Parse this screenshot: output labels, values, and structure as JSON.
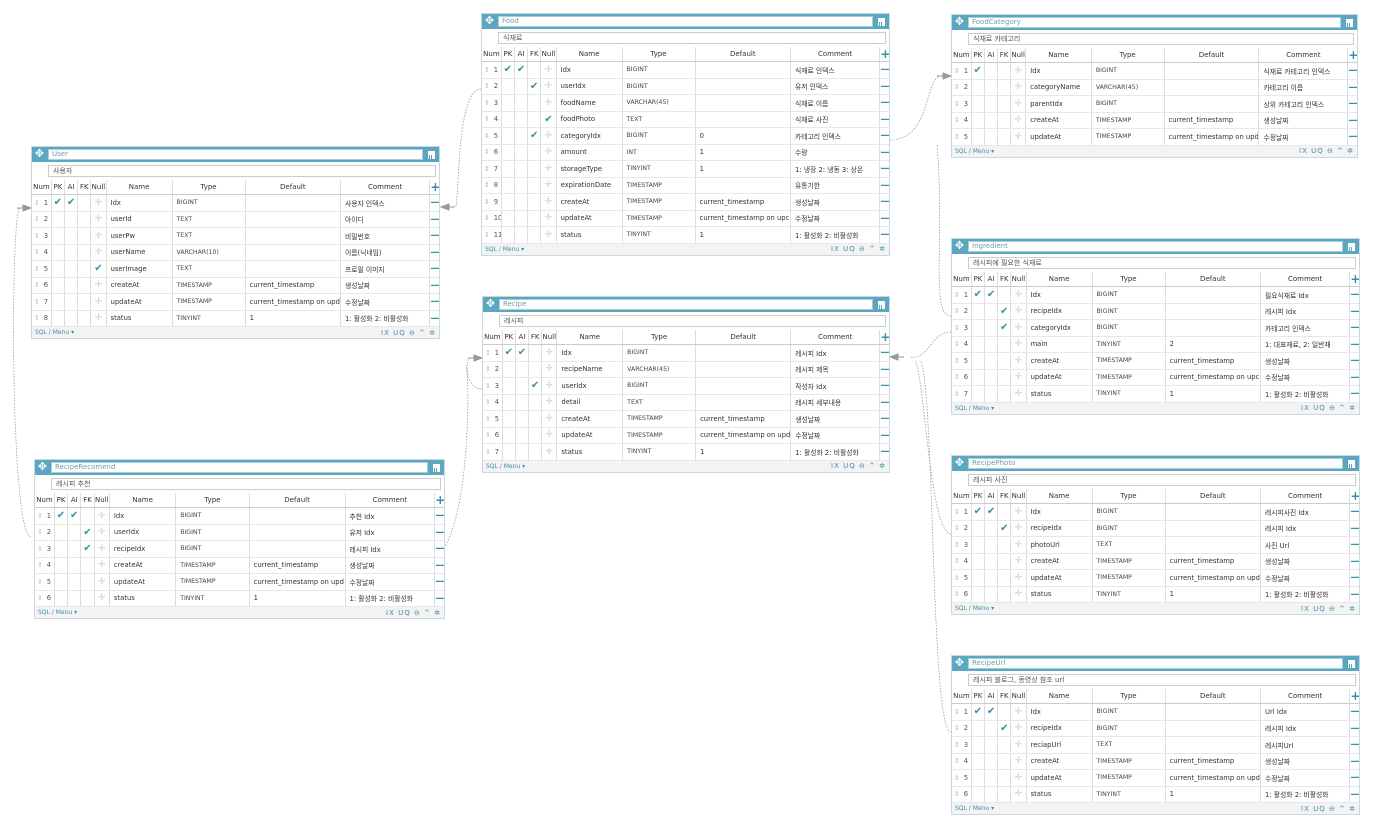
{
  "labels": {
    "num": "Num",
    "pk": "PK",
    "ai": "AI",
    "fk": "FK",
    "null": "Null",
    "name": "Name",
    "type": "Type",
    "default": "Default",
    "comment": "Comment",
    "sql_menu": "SQL / Menu",
    "footer_icons": "IX UQ ⊖ ^ ✲"
  },
  "colors": {
    "header": "#5aa7bf",
    "accent": "#3a8fa7",
    "link": "#999999"
  },
  "icons": {
    "drag": "move-icon",
    "delete": "trash-icon",
    "add": "plus-icon",
    "remove": "minus-icon",
    "pk": "check-icon",
    "null": "cross-icon",
    "handle": "drag-handle-icon"
  },
  "tables": [
    {
      "id": "user",
      "name": "User",
      "comment": "사용자",
      "rows": [
        {
          "n": "1",
          "pk": true,
          "ai": true,
          "fk": false,
          "nl": false,
          "name": "Idx",
          "type": "BIGINT",
          "def": "",
          "com": "사용자 인덱스"
        },
        {
          "n": "2",
          "pk": false,
          "ai": false,
          "fk": false,
          "nl": false,
          "name": "userId",
          "type": "TEXT",
          "def": "",
          "com": "아이디"
        },
        {
          "n": "3",
          "pk": false,
          "ai": false,
          "fk": false,
          "nl": false,
          "name": "userPw",
          "type": "TEXT",
          "def": "",
          "com": "비밀번호"
        },
        {
          "n": "4",
          "pk": false,
          "ai": false,
          "fk": false,
          "nl": false,
          "name": "userName",
          "type": "VARCHAR(10)",
          "def": "",
          "com": "이름(닉네임)"
        },
        {
          "n": "5",
          "pk": false,
          "ai": false,
          "fk": false,
          "nl": true,
          "name": "userImage",
          "type": "TEXT",
          "def": "",
          "com": "프로필 이미지"
        },
        {
          "n": "6",
          "pk": false,
          "ai": false,
          "fk": false,
          "nl": false,
          "name": "createAt",
          "type": "TIMESTAMP",
          "def": "current_timestamp",
          "com": "생성날짜"
        },
        {
          "n": "7",
          "pk": false,
          "ai": false,
          "fk": false,
          "nl": false,
          "name": "updateAt",
          "type": "TIMESTAMP",
          "def": "current_timestamp on upd",
          "com": "수정날짜"
        },
        {
          "n": "8",
          "pk": false,
          "ai": false,
          "fk": false,
          "nl": false,
          "name": "status",
          "type": "TINYINT",
          "def": "1",
          "com": "1: 활성화 2: 비활성화"
        }
      ]
    },
    {
      "id": "reciperecomend",
      "name": "RecipeRecomend",
      "comment": "레시피 추천",
      "rows": [
        {
          "n": "1",
          "pk": true,
          "ai": true,
          "fk": false,
          "nl": false,
          "name": "Idx",
          "type": "BIGINT",
          "def": "",
          "com": "추천 Idx"
        },
        {
          "n": "2",
          "pk": false,
          "ai": false,
          "fk": true,
          "nl": false,
          "name": "userIdx",
          "type": "BIGINT",
          "def": "",
          "com": "유저 Idx"
        },
        {
          "n": "3",
          "pk": false,
          "ai": false,
          "fk": true,
          "nl": false,
          "name": "recipeIdx",
          "type": "BIGINT",
          "def": "",
          "com": "레시피 Idx"
        },
        {
          "n": "4",
          "pk": false,
          "ai": false,
          "fk": false,
          "nl": false,
          "name": "createAt",
          "type": "TIMESTAMP",
          "def": "current_timestamp",
          "com": "생성날짜"
        },
        {
          "n": "5",
          "pk": false,
          "ai": false,
          "fk": false,
          "nl": false,
          "name": "updateAt",
          "type": "TIMESTAMP",
          "def": "current_timestamp on upd",
          "com": "수정날짜"
        },
        {
          "n": "6",
          "pk": false,
          "ai": false,
          "fk": false,
          "nl": false,
          "name": "status",
          "type": "TINYINT",
          "def": "1",
          "com": "1: 활성화 2: 비활성화"
        }
      ]
    },
    {
      "id": "food",
      "name": "Food",
      "comment": "식재료",
      "rows": [
        {
          "n": "1",
          "pk": true,
          "ai": true,
          "fk": false,
          "nl": false,
          "name": "Idx",
          "type": "BIGINT",
          "def": "",
          "com": "식재료 인덱스"
        },
        {
          "n": "2",
          "pk": false,
          "ai": false,
          "fk": true,
          "nl": false,
          "name": "userIdx",
          "type": "BIGINT",
          "def": "",
          "com": "유저 인덱스"
        },
        {
          "n": "3",
          "pk": false,
          "ai": false,
          "fk": false,
          "nl": false,
          "name": "foodName",
          "type": "VARCHAR(45)",
          "def": "",
          "com": "식재료 이름"
        },
        {
          "n": "4",
          "pk": false,
          "ai": false,
          "fk": false,
          "nl": true,
          "name": "foodPhoto",
          "type": "TEXT",
          "def": "",
          "com": "식재료 사진"
        },
        {
          "n": "5",
          "pk": false,
          "ai": false,
          "fk": true,
          "nl": false,
          "name": "categoryIdx",
          "type": "BIGINT",
          "def": "0",
          "com": "카테고리 인덱스"
        },
        {
          "n": "6",
          "pk": false,
          "ai": false,
          "fk": false,
          "nl": false,
          "name": "amount",
          "type": "INT",
          "def": "1",
          "com": "수량"
        },
        {
          "n": "7",
          "pk": false,
          "ai": false,
          "fk": false,
          "nl": false,
          "name": "storageType",
          "type": "TINYINT",
          "def": "1",
          "com": "1: 냉장 2: 냉동 3: 상온"
        },
        {
          "n": "8",
          "pk": false,
          "ai": false,
          "fk": false,
          "nl": false,
          "name": "expirationDate",
          "type": "TIMESTAMP",
          "def": "",
          "com": "유통기한"
        },
        {
          "n": "9",
          "pk": false,
          "ai": false,
          "fk": false,
          "nl": false,
          "name": "createAt",
          "type": "TIMESTAMP",
          "def": "current_timestamp",
          "com": "생성날짜"
        },
        {
          "n": "10",
          "pk": false,
          "ai": false,
          "fk": false,
          "nl": false,
          "name": "updateAt",
          "type": "TIMESTAMP",
          "def": "current_timestamp on upc",
          "com": "수정날짜"
        },
        {
          "n": "11",
          "pk": false,
          "ai": false,
          "fk": false,
          "nl": false,
          "name": "status",
          "type": "TINYINT",
          "def": "1",
          "com": "1: 활성화 2: 비활성화"
        }
      ]
    },
    {
      "id": "recipe",
      "name": "Recipe",
      "comment": "레시피",
      "rows": [
        {
          "n": "1",
          "pk": true,
          "ai": true,
          "fk": false,
          "nl": false,
          "name": "Idx",
          "type": "BIGINT",
          "def": "",
          "com": "레시피 Idx"
        },
        {
          "n": "2",
          "pk": false,
          "ai": false,
          "fk": false,
          "nl": false,
          "name": "recipeName",
          "type": "VARCHAR(45)",
          "def": "",
          "com": "레시피 제목"
        },
        {
          "n": "3",
          "pk": false,
          "ai": false,
          "fk": true,
          "nl": false,
          "name": "userIdx",
          "type": "BIGINT",
          "def": "",
          "com": "작성자 Idx"
        },
        {
          "n": "4",
          "pk": false,
          "ai": false,
          "fk": false,
          "nl": false,
          "name": "detail",
          "type": "TEXT",
          "def": "",
          "com": "레시피 세부내용"
        },
        {
          "n": "5",
          "pk": false,
          "ai": false,
          "fk": false,
          "nl": false,
          "name": "createAt",
          "type": "TIMESTAMP",
          "def": "current_timestamp",
          "com": "생성날짜"
        },
        {
          "n": "6",
          "pk": false,
          "ai": false,
          "fk": false,
          "nl": false,
          "name": "updateAt",
          "type": "TIMESTAMP",
          "def": "current_timestamp on upd",
          "com": "수정날짜"
        },
        {
          "n": "7",
          "pk": false,
          "ai": false,
          "fk": false,
          "nl": false,
          "name": "status",
          "type": "TINYINT",
          "def": "1",
          "com": "1: 활성화 2: 비활성화"
        }
      ]
    },
    {
      "id": "foodcategory",
      "name": "FoodCategory",
      "comment": "식재료 카테고리",
      "rows": [
        {
          "n": "1",
          "pk": true,
          "ai": false,
          "fk": false,
          "nl": false,
          "name": "Idx",
          "type": "BIGINT",
          "def": "",
          "com": "식재료 카테고리 인덱스"
        },
        {
          "n": "2",
          "pk": false,
          "ai": false,
          "fk": false,
          "nl": false,
          "name": "categoryName",
          "type": "VARCHAR(45)",
          "def": "",
          "com": "카테고리 이름"
        },
        {
          "n": "3",
          "pk": false,
          "ai": false,
          "fk": false,
          "nl": false,
          "name": "parentIdx",
          "type": "BIGINT",
          "def": "",
          "com": "상위 카테고리 인덱스"
        },
        {
          "n": "4",
          "pk": false,
          "ai": false,
          "fk": false,
          "nl": false,
          "name": "createAt",
          "type": "TIMESTAMP",
          "def": "current_timestamp",
          "com": "생성날짜"
        },
        {
          "n": "5",
          "pk": false,
          "ai": false,
          "fk": false,
          "nl": false,
          "name": "updateAt",
          "type": "TIMESTAMP",
          "def": "current_timestamp on upd",
          "com": "수정날짜"
        }
      ]
    },
    {
      "id": "ingredient",
      "name": "Ingredient",
      "comment": "레시피에 필요한 식재료",
      "rows": [
        {
          "n": "1",
          "pk": true,
          "ai": true,
          "fk": false,
          "nl": false,
          "name": "Idx",
          "type": "BIGINT",
          "def": "",
          "com": "필요식재료 Idx"
        },
        {
          "n": "2",
          "pk": false,
          "ai": false,
          "fk": true,
          "nl": false,
          "name": "recipeIdx",
          "type": "BIGINT",
          "def": "",
          "com": "레시피 Idx"
        },
        {
          "n": "3",
          "pk": false,
          "ai": false,
          "fk": true,
          "nl": false,
          "name": "categoryIdx",
          "type": "BIGINT",
          "def": "",
          "com": "카테고리 인덱스"
        },
        {
          "n": "4",
          "pk": false,
          "ai": false,
          "fk": false,
          "nl": false,
          "name": "main",
          "type": "TINYINT",
          "def": "2",
          "com": "1: 대표재료, 2: 일반재"
        },
        {
          "n": "5",
          "pk": false,
          "ai": false,
          "fk": false,
          "nl": false,
          "name": "createAt",
          "type": "TIMESTAMP",
          "def": "current_timestamp",
          "com": "생성날짜"
        },
        {
          "n": "6",
          "pk": false,
          "ai": false,
          "fk": false,
          "nl": false,
          "name": "updateAt",
          "type": "TIMESTAMP",
          "def": "current_timestamp on upc",
          "com": "수정날짜"
        },
        {
          "n": "7",
          "pk": false,
          "ai": false,
          "fk": false,
          "nl": false,
          "name": "status",
          "type": "TINYINT",
          "def": "1",
          "com": "1: 활성화 2: 비활성화"
        }
      ]
    },
    {
      "id": "recipephoto",
      "name": "RecipePhoto",
      "comment": "레시피 사진",
      "rows": [
        {
          "n": "1",
          "pk": true,
          "ai": true,
          "fk": false,
          "nl": false,
          "name": "Idx",
          "type": "BIGINT",
          "def": "",
          "com": "레시피사진 Idx"
        },
        {
          "n": "2",
          "pk": false,
          "ai": false,
          "fk": true,
          "nl": false,
          "name": "recipeIdx",
          "type": "BIGINT",
          "def": "",
          "com": "레시피 Idx"
        },
        {
          "n": "3",
          "pk": false,
          "ai": false,
          "fk": false,
          "nl": false,
          "name": "photoUrl",
          "type": "TEXT",
          "def": "",
          "com": "사진 Url"
        },
        {
          "n": "4",
          "pk": false,
          "ai": false,
          "fk": false,
          "nl": false,
          "name": "createAt",
          "type": "TIMESTAMP",
          "def": "current_timestamp",
          "com": "생성날짜"
        },
        {
          "n": "5",
          "pk": false,
          "ai": false,
          "fk": false,
          "nl": false,
          "name": "updateAt",
          "type": "TIMESTAMP",
          "def": "current_timestamp on upd",
          "com": "수정날짜"
        },
        {
          "n": "6",
          "pk": false,
          "ai": false,
          "fk": false,
          "nl": false,
          "name": "status",
          "type": "TINYINT",
          "def": "1",
          "com": "1: 활성화 2: 비활성화"
        }
      ]
    },
    {
      "id": "recipeurl",
      "name": "RecipeUrl",
      "comment": "레시피 블로그, 동영상 참조 url",
      "rows": [
        {
          "n": "1",
          "pk": true,
          "ai": true,
          "fk": false,
          "nl": false,
          "name": "Idx",
          "type": "BIGINT",
          "def": "",
          "com": "Url Idx"
        },
        {
          "n": "2",
          "pk": false,
          "ai": false,
          "fk": true,
          "nl": false,
          "name": "recipeIdx",
          "type": "BIGINT",
          "def": "",
          "com": "레시피 Idx"
        },
        {
          "n": "3",
          "pk": false,
          "ai": false,
          "fk": false,
          "nl": false,
          "name": "reciapUrl",
          "type": "TEXT",
          "def": "",
          "com": "레시피Url"
        },
        {
          "n": "4",
          "pk": false,
          "ai": false,
          "fk": false,
          "nl": false,
          "name": "createAt",
          "type": "TIMESTAMP",
          "def": "current_timestamp",
          "com": "생성날짜"
        },
        {
          "n": "5",
          "pk": false,
          "ai": false,
          "fk": false,
          "nl": false,
          "name": "updateAt",
          "type": "TIMESTAMP",
          "def": "current_timestamp on upd",
          "com": "수정날짜"
        },
        {
          "n": "6",
          "pk": false,
          "ai": false,
          "fk": false,
          "nl": false,
          "name": "status",
          "type": "TINYINT",
          "def": "1",
          "com": "1: 활성화 2: 비활성화"
        }
      ]
    }
  ]
}
